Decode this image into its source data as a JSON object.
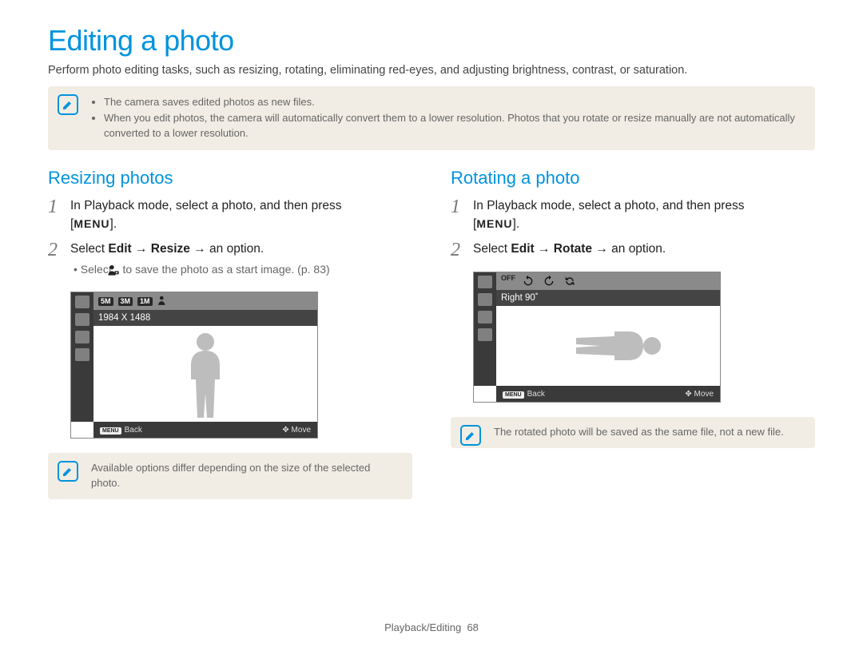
{
  "title": "Editing a photo",
  "intro": "Perform photo editing tasks, such as resizing, rotating, eliminating red-eyes, and adjusting brightness, contrast, or saturation.",
  "top_note": {
    "items": [
      "The camera saves edited photos as new files.",
      "When you edit photos, the camera will automatically convert them to a lower resolution. Photos that you rotate or resize manually are not automatically converted to a lower resolution."
    ]
  },
  "left": {
    "heading": "Resizing photos",
    "step1": "In Playback mode, select a photo, and then press",
    "menu_label": "MENU",
    "step2_prefix": "Select ",
    "step2_seq": "Edit → Resize → an option.",
    "step2_bullet": "Select    to save the photo as a start image. (p. 83)",
    "lcd": {
      "topbar_chips": [
        "5M",
        "3M",
        "1M"
      ],
      "toolbar_text": "1984 X 1488",
      "footer_back": "Back",
      "footer_move": "Move"
    },
    "note": "Available options differ depending on the size of the selected photo."
  },
  "right": {
    "heading": "Rotating a photo",
    "step1": "In Playback mode, select a photo, and then press",
    "menu_label": "MENU",
    "step2_prefix": "Select ",
    "step2_seq": "Edit → Rotate → an option.",
    "lcd": {
      "toolbar_text": "Right 90˚",
      "footer_back": "Back",
      "footer_move": "Move"
    },
    "note": "The rotated photo will be saved as the same file, not a new file."
  },
  "footer": {
    "section": "Playback/Editing",
    "page": "68"
  }
}
